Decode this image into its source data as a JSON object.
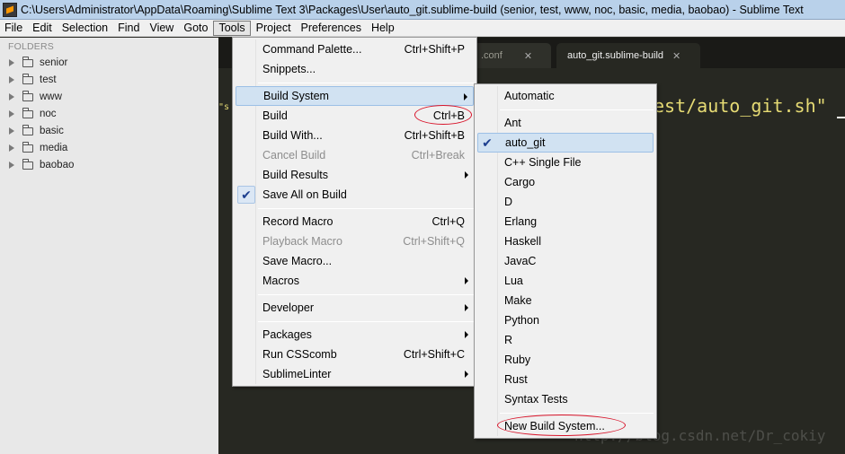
{
  "window": {
    "title": "C:\\Users\\Administrator\\AppData\\Roaming\\Sublime Text 3\\Packages\\User\\auto_git.sublime-build (senior, test, www, noc, basic, media, baobao) - Sublime Text"
  },
  "menubar": {
    "items": [
      "File",
      "Edit",
      "Selection",
      "Find",
      "View",
      "Goto",
      "Tools",
      "Project",
      "Preferences",
      "Help"
    ],
    "active": "Tools"
  },
  "sidebar": {
    "title": "FOLDERS",
    "folders": [
      "senior",
      "test",
      "www",
      "noc",
      "basic",
      "media",
      "baobao"
    ]
  },
  "tabs": [
    {
      "label": ".conf",
      "active": false
    },
    {
      "label": "auto_git.sublime-build",
      "active": true
    }
  ],
  "editor": {
    "code_fragment": "est/auto_git.sh\"",
    "left_fragment": "\"s"
  },
  "tools_menu": {
    "command_palette": {
      "label": "Command Palette...",
      "shortcut": "Ctrl+Shift+P"
    },
    "snippets": {
      "label": "Snippets..."
    },
    "build_system": {
      "label": "Build System"
    },
    "build": {
      "label": "Build",
      "shortcut": "Ctrl+B"
    },
    "build_with": {
      "label": "Build With...",
      "shortcut": "Ctrl+Shift+B"
    },
    "cancel_build": {
      "label": "Cancel Build",
      "shortcut": "Ctrl+Break"
    },
    "build_results": {
      "label": "Build Results"
    },
    "save_all_on_build": {
      "label": "Save All on Build",
      "checked": true
    },
    "record_macro": {
      "label": "Record Macro",
      "shortcut": "Ctrl+Q"
    },
    "playback_macro": {
      "label": "Playback Macro",
      "shortcut": "Ctrl+Shift+Q"
    },
    "save_macro": {
      "label": "Save Macro..."
    },
    "macros": {
      "label": "Macros"
    },
    "developer": {
      "label": "Developer"
    },
    "packages": {
      "label": "Packages"
    },
    "run_csscomb": {
      "label": "Run CSScomb",
      "shortcut": "Ctrl+Shift+C"
    },
    "sublimelinter": {
      "label": "SublimeLinter"
    }
  },
  "build_system_menu": {
    "automatic": "Automatic",
    "items": [
      "Ant",
      "auto_git",
      "C++ Single File",
      "Cargo",
      "D",
      "Erlang",
      "Haskell",
      "JavaC",
      "Lua",
      "Make",
      "Python",
      "R",
      "Ruby",
      "Rust",
      "Syntax Tests"
    ],
    "selected": "auto_git",
    "new_build_system": "New Build System..."
  },
  "watermark": "http://blog.csdn.net/Dr_cokiy",
  "colors": {
    "annotation_red": "#d8142a",
    "check_blue": "#1d3f8f",
    "highlight": "#d1e2f2",
    "editor_bg": "#272822",
    "string_yellow": "#e6db74"
  }
}
